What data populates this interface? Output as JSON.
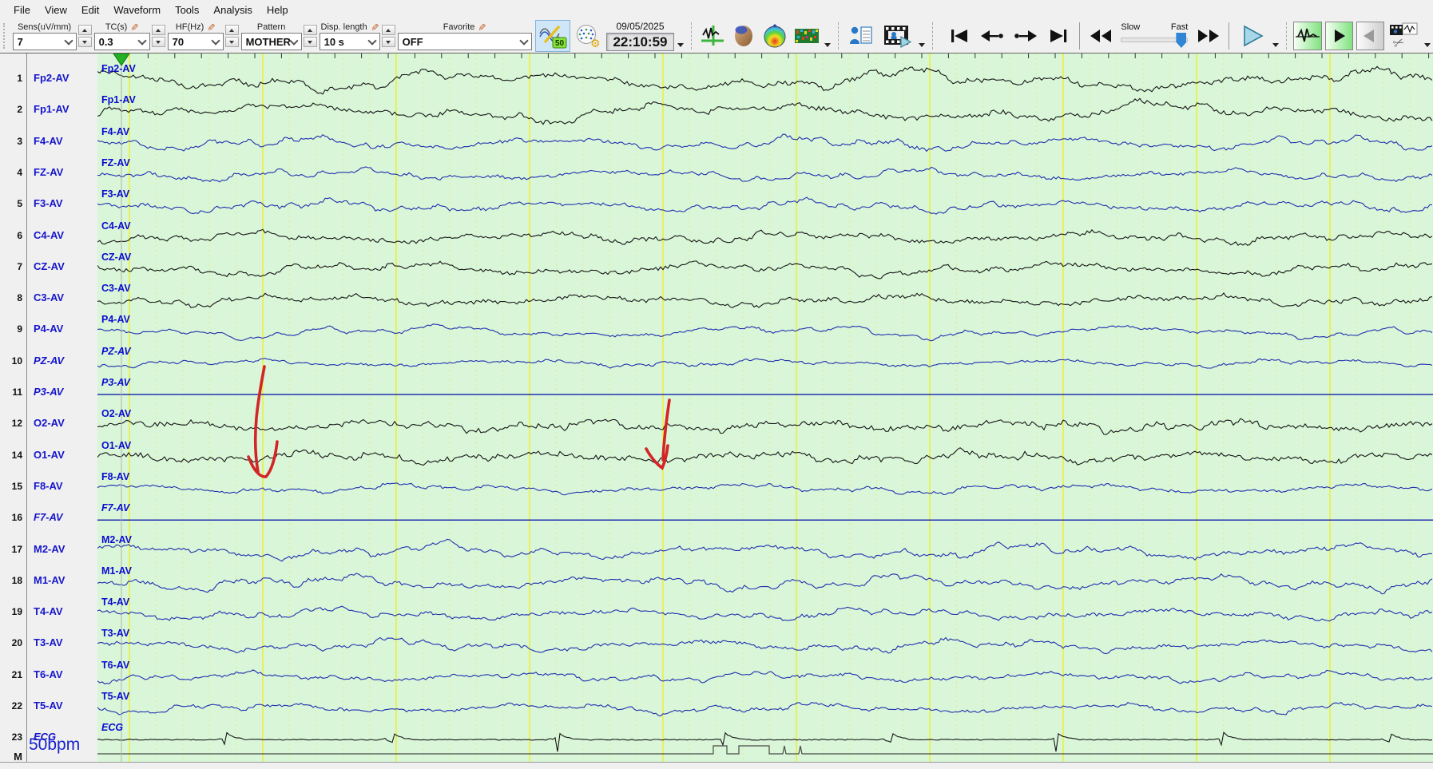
{
  "menu": {
    "items": [
      "File",
      "View",
      "Edit",
      "Waveform",
      "Tools",
      "Analysis",
      "Help"
    ]
  },
  "toolbar": {
    "params": [
      {
        "label": "Sens(uV/mm)",
        "value": "7",
        "pencil": false
      },
      {
        "label": "TC(s)",
        "value": "0.3",
        "pencil": true
      },
      {
        "label": "HF(Hz)",
        "value": "70",
        "pencil": true
      },
      {
        "label": "Pattern",
        "value": "MOTHER",
        "pencil": false
      },
      {
        "label": "Disp. length",
        "value": "10 s",
        "pencil": true
      },
      {
        "label": "Favorite",
        "value": "OFF",
        "pencil": true
      }
    ],
    "filter_button": {
      "badge": "50"
    },
    "datetime": {
      "date": "09/05/2025",
      "time": "22:10:59"
    },
    "speed_slider": {
      "slow_label": "Slow",
      "fast_label": "Fast"
    }
  },
  "channels": [
    {
      "n": "1",
      "label": "Fp2-AV",
      "italic": false,
      "color": "black",
      "kind": "eeg",
      "amp": 13,
      "f": 0.75,
      "jit": 2.6
    },
    {
      "n": "2",
      "label": "Fp1-AV",
      "italic": false,
      "color": "black",
      "kind": "eeg",
      "amp": 12,
      "f": 0.7,
      "jit": 2.6
    },
    {
      "n": "3",
      "label": "F4-AV",
      "italic": false,
      "color": "blue",
      "kind": "eeg",
      "amp": 8,
      "f": 1.25,
      "jit": 1.8
    },
    {
      "n": "4",
      "label": "FZ-AV",
      "italic": false,
      "color": "blue",
      "kind": "eeg",
      "amp": 7,
      "f": 1.1,
      "jit": 1.6
    },
    {
      "n": "5",
      "label": "F3-AV",
      "italic": false,
      "color": "blue",
      "kind": "eeg",
      "amp": 7.5,
      "f": 1.3,
      "jit": 1.8
    },
    {
      "n": "6",
      "label": "C4-AV",
      "italic": false,
      "color": "black",
      "kind": "eeg",
      "amp": 7,
      "f": 1.15,
      "jit": 2.2
    },
    {
      "n": "7",
      "label": "CZ-AV",
      "italic": false,
      "color": "black",
      "kind": "eeg",
      "amp": 8,
      "f": 0.95,
      "jit": 2.2
    },
    {
      "n": "8",
      "label": "C3-AV",
      "italic": false,
      "color": "black",
      "kind": "eeg",
      "amp": 6.5,
      "f": 1.1,
      "jit": 2.2
    },
    {
      "n": "9",
      "label": "P4-AV",
      "italic": false,
      "color": "blue",
      "kind": "eeg",
      "amp": 8,
      "f": 0.9,
      "jit": 1.2
    },
    {
      "n": "10",
      "label": "PZ-AV",
      "italic": true,
      "color": "blue",
      "kind": "eeg",
      "amp": 4.5,
      "f": 1.2,
      "jit": 1.2
    },
    {
      "n": "11",
      "label": "P3-AV",
      "italic": true,
      "color": "blue",
      "kind": "flat",
      "amp": 0,
      "f": 1,
      "jit": 0
    },
    {
      "n": "12",
      "label": "O2-AV",
      "italic": false,
      "color": "black",
      "kind": "eeg",
      "amp": 7,
      "f": 1.5,
      "jit": 2.8
    },
    {
      "n": "14",
      "label": "O1-AV",
      "italic": false,
      "color": "black",
      "kind": "eeg",
      "amp": 7,
      "f": 1.45,
      "jit": 2.8
    },
    {
      "n": "15",
      "label": "F8-AV",
      "italic": false,
      "color": "blue",
      "kind": "eeg",
      "amp": 6,
      "f": 1.0,
      "jit": 1.5
    },
    {
      "n": "16",
      "label": "F7-AV",
      "italic": true,
      "color": "blue",
      "kind": "flat",
      "amp": 0,
      "f": 1,
      "jit": 0
    },
    {
      "n": "17",
      "label": "M2-AV",
      "italic": false,
      "color": "blue",
      "kind": "eeg",
      "amp": 9.5,
      "f": 1.05,
      "jit": 2.0
    },
    {
      "n": "18",
      "label": "M1-AV",
      "italic": false,
      "color": "blue",
      "kind": "eeg",
      "amp": 9,
      "f": 1.1,
      "jit": 2.0
    },
    {
      "n": "19",
      "label": "T4-AV",
      "italic": false,
      "color": "blue",
      "kind": "eeg",
      "amp": 7,
      "f": 1.15,
      "jit": 1.8
    },
    {
      "n": "20",
      "label": "T3-AV",
      "italic": false,
      "color": "blue",
      "kind": "eeg",
      "amp": 7.5,
      "f": 1.1,
      "jit": 1.8
    },
    {
      "n": "21",
      "label": "T6-AV",
      "italic": false,
      "color": "blue",
      "kind": "eeg",
      "amp": 6,
      "f": 1.2,
      "jit": 1.6
    },
    {
      "n": "22",
      "label": "T5-AV",
      "italic": false,
      "color": "blue",
      "kind": "eeg",
      "amp": 6,
      "f": 1.15,
      "jit": 1.6
    },
    {
      "n": "23",
      "label": "ECG",
      "italic": true,
      "color": "black",
      "kind": "ecg",
      "amp": 15,
      "f": 1,
      "jit": 0.6
    }
  ],
  "marker_row": {
    "num": "M"
  },
  "heart_rate": "50bpm",
  "colors": {
    "plot_bg": "#d9f6d9",
    "grid_major": "#eded2a",
    "grid_minor": "#e4ea8e",
    "trace_blue": "#2130ae",
    "trace_black": "#161616",
    "marker_gray": "#4a4a4a",
    "label_blue": "#0b0bd0",
    "annotation_red": "#d32525",
    "selected_button": "#cfe6f8"
  }
}
